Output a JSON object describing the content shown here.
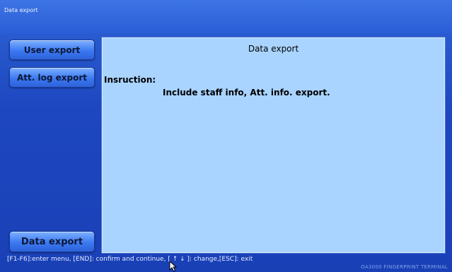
{
  "window": {
    "title": "Data export"
  },
  "sidebar": {
    "items": [
      {
        "label": "User export"
      },
      {
        "label": "Att. log export"
      },
      {
        "label": "Data export"
      }
    ]
  },
  "panel": {
    "title": "Data export",
    "instruction_label": "Insruction:",
    "instruction_text": "Include staff info, Att. info. export."
  },
  "statusbar": {
    "hint": "[F1-F6]:enter menu, [END]: confirm and continue, [ ↑ ↓ ]: change,[ESC]: exit",
    "brand": "OA3000 FINGERPRINT TERMINAL"
  },
  "icons": {
    "cursor": "arrow-cursor-icon"
  },
  "colors": {
    "background": "#1d47c0",
    "panel": "#a9d4ff",
    "button": "#3b79f2"
  }
}
